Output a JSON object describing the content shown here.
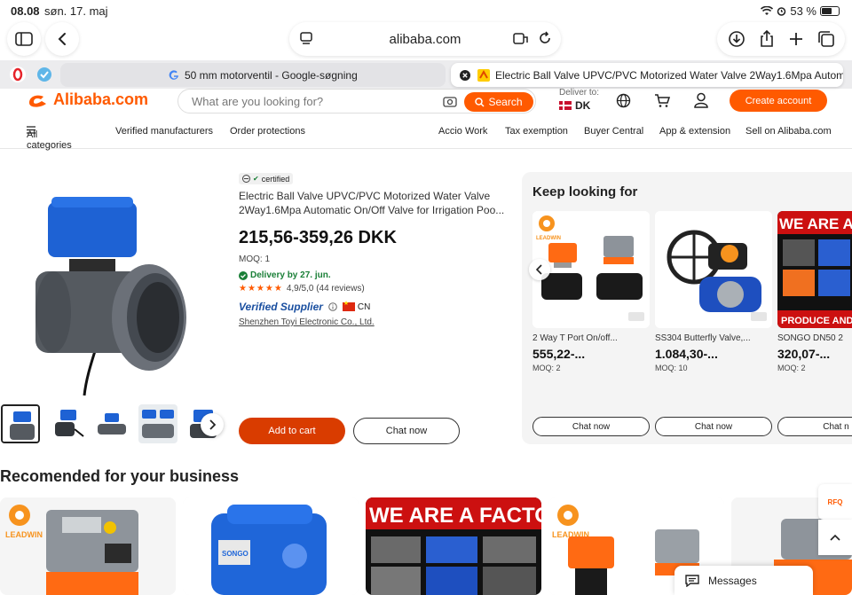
{
  "status_bar": {
    "time": "08.08",
    "date": "søn. 17. maj",
    "battery": "53 %",
    "battery_level": 0.53
  },
  "browser": {
    "url": "alibaba.com",
    "tabs": [
      {
        "title": "50 mm motorventil - Google-søgning"
      },
      {
        "title": "Electric Ball Valve UPVC/PVC Motorized Water Valve 2Way1.6Mpa Autom..."
      }
    ]
  },
  "header": {
    "logo_text": "Alibaba.com",
    "search_placeholder": "What are you looking for?",
    "search_button": "Search",
    "deliver_to_label": "Deliver to:",
    "deliver_country": "DK",
    "create_account": "Create account"
  },
  "subnav": {
    "all_categories": "All categories",
    "items_left": [
      "Verified manufacturers",
      "Order protections"
    ],
    "items_right": [
      "Accio Work",
      "Tax exemption",
      "Buyer Central",
      "App & extension",
      "Sell on Alibaba.com"
    ]
  },
  "product": {
    "certified_label": "certified",
    "title": "Electric Ball Valve UPVC/PVC Motorized Water Valve 2Way1.6Mpa Automatic On/Off Valve for Irrigation Poo...",
    "price": "215,56-359,26 DKK",
    "moq": "MOQ: 1",
    "delivery": "Delivery by 27. jun.",
    "rating": "4,9/5,0 (44 reviews)",
    "stars": "★★★★★",
    "verified_supplier": "Verified Supplier",
    "country": "CN",
    "supplier_name": "Shenzhen Toyi Electronic Co., Ltd.",
    "add_to_cart": "Add to cart",
    "chat_now": "Chat now"
  },
  "keep_looking": {
    "heading": "Keep looking for",
    "items": [
      {
        "name": "2 Way T Port On/off...",
        "price": "555,22-...",
        "moq": "MOQ: 2",
        "chat": "Chat now"
      },
      {
        "name": "SS304 Butterfly Valve,...",
        "price": "1.084,30-...",
        "moq": "MOQ: 10",
        "chat": "Chat now"
      },
      {
        "name": "SONGO DN50 2",
        "price": "320,07-...",
        "moq": "MOQ: 2",
        "chat": "Chat n",
        "banner_top": "WE ARE A FA",
        "banner_bottom": "PRODUCE AND SAL"
      }
    ]
  },
  "recommended": {
    "title": "Recomended for your business",
    "brand_leadwin": "LEADWIN",
    "brand_songo": "SONGO",
    "factory_banner": "WE ARE A FACTORY"
  },
  "floating": {
    "rfq": "RFQ",
    "messages": "Messages"
  },
  "colors": {
    "accent": "#ff5a00",
    "verified_blue": "#1a4fa0",
    "delivery_green": "#1a7f37"
  }
}
